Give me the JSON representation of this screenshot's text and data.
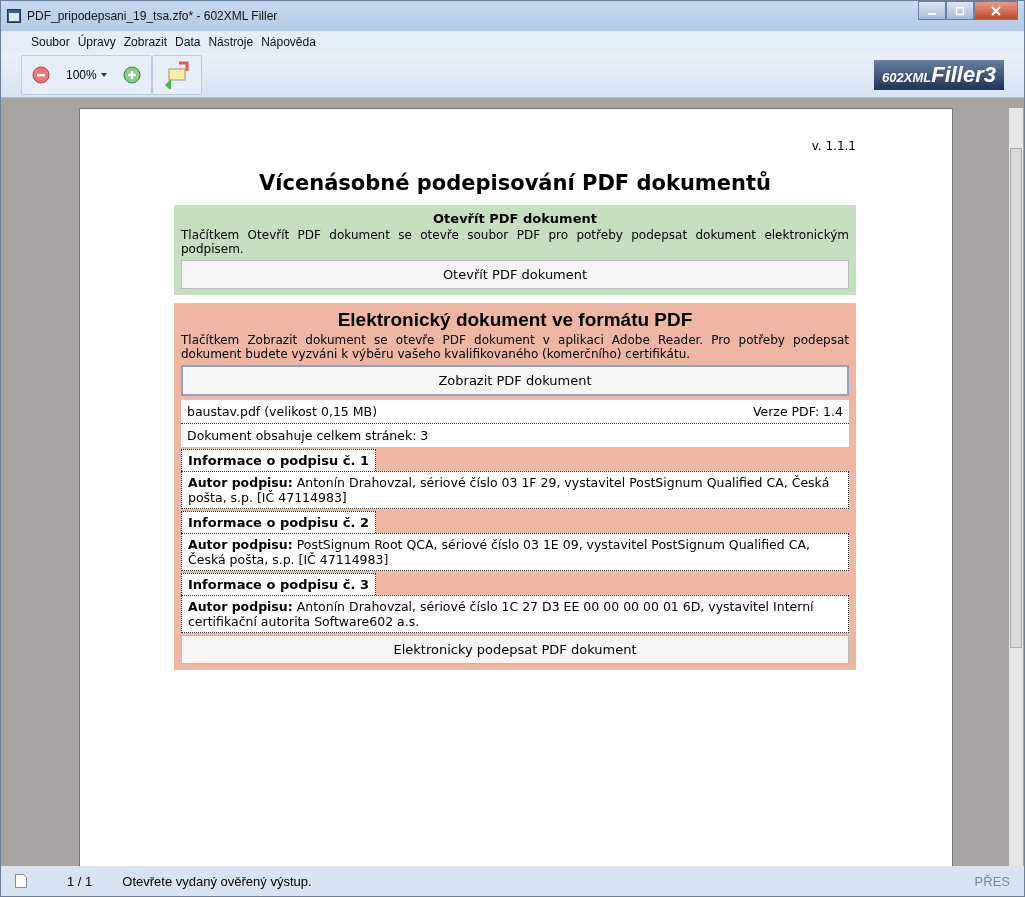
{
  "window": {
    "title": "PDF_pripodepsani_19_tsa.zfo* - 602XML Filler"
  },
  "menu": [
    "Soubor",
    "Úpravy",
    "Zobrazit",
    "Data",
    "Nástroje",
    "Nápověda"
  ],
  "toolbar": {
    "zoom": "100%",
    "logo_left": "602XML",
    "logo_right": "Filler3"
  },
  "document": {
    "version": "v. 1.1.1",
    "title": "Vícenásobné podepisování PDF dokumentů",
    "open_section": {
      "heading": "Otevřít PDF dokument",
      "text": "Tlačítkem Otevřít PDF dokument se otevře soubor PDF pro potřeby podepsat dokument elektronickým podpisem.",
      "button": "Otevřít PDF dokument"
    },
    "pdf_section": {
      "heading": "Elektronický dokument ve formátu PDF",
      "text": "Tlačítkem Zobrazit dokument se otevře PDF dokument v aplikaci Adobe Reader. Pro potřeby podepsat dokument budete vyzváni k výběru vašeho kvalifikovaného (komerčního) certifikátu.",
      "button": "Zobrazit PDF dokument",
      "file": "baustav.pdf (velikost 0,15 MB)",
      "pdf_version": "Verze PDF: 1.4",
      "pages": "Dokument obsahuje celkem stránek: 3",
      "signatures": [
        {
          "heading": "Informace o podpisu č. 1",
          "author": "**Autor podpisu:** Antonín Drahovzal, sériové číslo 03 1F 29, vystavitel PostSignum Qualified CA, Česká pošta, s.p. [IČ 47114983]"
        },
        {
          "heading": "Informace o podpisu č. 2",
          "author": "**Autor podpisu:** PostSignum Root QCA, sériové číslo 03 1E 09, vystavitel PostSignum Qualified CA, Česká pošta, s.p. [IČ 47114983]"
        },
        {
          "heading": "Informace o podpisu č. 3",
          "author": "**Autor podpisu:** Antonín Drahovzal, sériové číslo 1C 27 D3 EE 00 00 00 00 01 6D, vystavitel Interní certifikační autorita Software602 a.s."
        }
      ],
      "sign_button": "Elektronicky podepsat PDF dokument"
    }
  },
  "status_bar": {
    "page": "1 / 1",
    "message": "Otevřete vydaný ověřený výstup.",
    "mode": "PŘES",
    "mode_disabled": true
  }
}
